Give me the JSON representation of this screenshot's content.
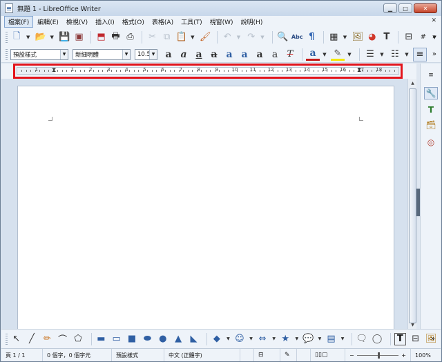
{
  "window": {
    "title": "無題 1 - LibreOffice Writer",
    "minimize": "▁",
    "maximize": "□",
    "close": "✕"
  },
  "menu": {
    "items": [
      "檔案(F)",
      "編輯(E)",
      "檢視(V)",
      "插入(I)",
      "格式(O)",
      "表格(A)",
      "工具(T)",
      "視窗(W)",
      "說明(H)"
    ],
    "close_glyph": "✕"
  },
  "toolbar_standard": {
    "icons": [
      "new-document-icon",
      "open-folder-icon",
      "save-icon",
      "export-pdf-icon",
      "pdf-direct-icon",
      "print-icon",
      "print-preview-icon",
      "cut-icon",
      "copy-icon",
      "paste-icon",
      "clone-formatting-icon",
      "undo-icon",
      "redo-icon",
      "find-replace-icon",
      "spellcheck-icon",
      "formatting-marks-icon",
      "table-icon",
      "image-icon",
      "chart-icon",
      "text-box-icon",
      "page-break-icon",
      "field-icon"
    ],
    "spellcheck_label": "Abc",
    "formatting_mark": "¶",
    "field_glyph": "#"
  },
  "toolbar_formatting": {
    "paragraph_style": "預設樣式",
    "font_name": "新細明體",
    "font_size": "10.5",
    "glyph_a": "a",
    "clear_format": "T",
    "more": "»"
  },
  "ruler": {
    "numbers": [
      "1",
      "1",
      "2",
      "3",
      "4",
      "5",
      "6",
      "7",
      "8",
      "9",
      "10",
      "11",
      "12",
      "13",
      "14",
      "15",
      "16",
      "17",
      "18"
    ]
  },
  "drawing_toolbar": {
    "icons": [
      "select-icon",
      "line-icon",
      "freeform-line-icon",
      "curve-icon",
      "polygon-icon",
      "rectangle-icon",
      "rounded-rectangle-icon",
      "square-icon",
      "ellipse-icon",
      "circle-icon",
      "triangle-icon",
      "right-triangle-icon",
      "diamond-icon",
      "smiley-icon",
      "double-arrow-icon",
      "star-icon",
      "callout-icon",
      "flowchart-icon",
      "speech-bubble-icon",
      "thought-bubble-icon",
      "text-icon",
      "insert-frame-icon",
      "image-toolbar-icon"
    ]
  },
  "status": {
    "page": "頁 1 / 1",
    "word_count": "0 個字，0 個字元",
    "page_style": "預設樣式",
    "language": "中文 (正體字)",
    "zoom": "100%",
    "zoom_minus": "−",
    "zoom_plus": "+"
  },
  "colors": {
    "highlight_box": "#e3141c",
    "chrome": "#eef3f9",
    "doc_background": "#d6e1ee"
  }
}
